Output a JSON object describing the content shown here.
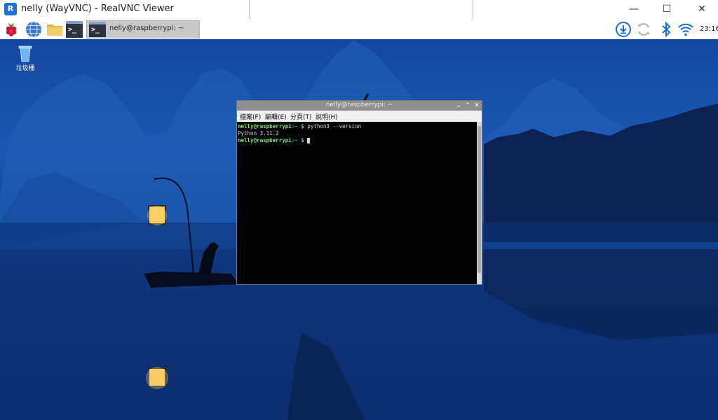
{
  "vnc": {
    "app_icon_text": "R",
    "title": "nelly (WayVNC) - RealVNC Viewer",
    "controls": {
      "minimize": "—",
      "maximize": "☐",
      "close": "✕"
    }
  },
  "taskbar": {
    "window_button_label": "nelly@raspberrypi: ~",
    "launcher_icons": [
      "raspberry-menu",
      "web-browser",
      "file-manager",
      "terminal"
    ],
    "tray_icons": [
      "updates",
      "sync",
      "bluetooth",
      "wifi"
    ],
    "clock": "23:16",
    "terminal_glyph": ">_"
  },
  "desktop": {
    "trash_label": "垃圾桶"
  },
  "terminal": {
    "title": "nelly@raspberrypi: ~",
    "controls": {
      "minimize": "⌄",
      "maximize": "⌃",
      "close": "✕"
    },
    "menu": {
      "file": "檔案(F)",
      "edit": "編輯(E)",
      "tabs": "分頁(T)",
      "help": "說明(H)"
    },
    "lines": [
      {
        "user": "nelly@raspberrypi",
        "path": ":~",
        "symbol": " $ ",
        "command": "python3 --version"
      },
      {
        "output": "Python 3.11.2"
      },
      {
        "user": "nelly@raspberrypi",
        "path": ":~",
        "symbol": " $ "
      }
    ]
  },
  "colors": {
    "prompt_user": "#7ee65d",
    "prompt_path": "#6b8cff",
    "taskbar_active": "#c8c8c8"
  }
}
